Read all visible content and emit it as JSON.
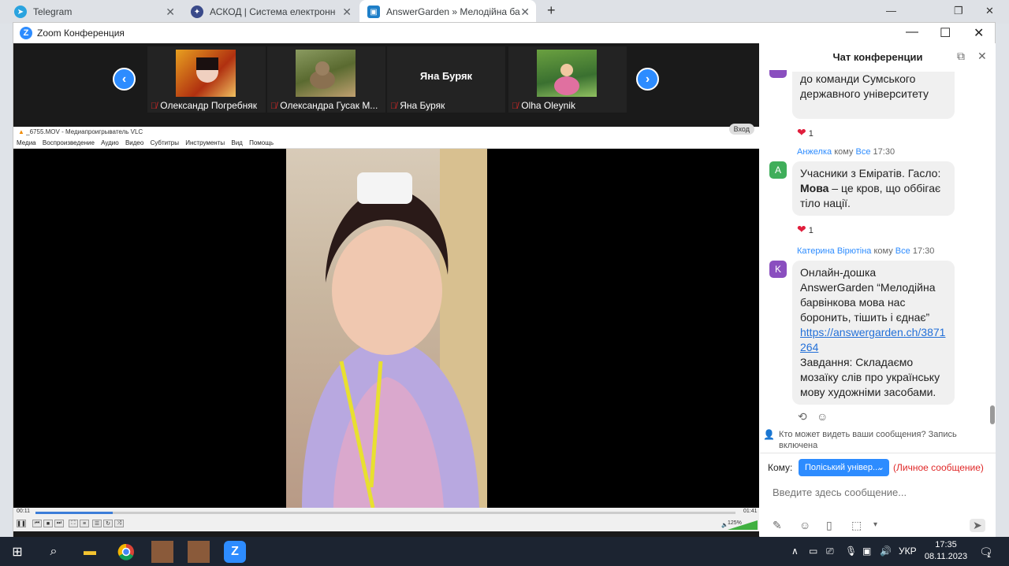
{
  "browser": {
    "tabs": [
      {
        "title": "Telegram",
        "icon": "telegram-icon",
        "active": false
      },
      {
        "title": "АСКОД | Система електронного",
        "icon": "askod-icon",
        "active": false
      },
      {
        "title": "AnswerGarden » Мелодійна бар",
        "icon": "answergarden-icon",
        "active": true
      }
    ],
    "new_tab": "+",
    "minimize": "—",
    "restore": "❐",
    "close": "✕"
  },
  "zoom": {
    "title": "Zoom Конференция",
    "logo": "Z",
    "minimize": "—",
    "maximize": "☐",
    "close": "✕",
    "participants": [
      {
        "name": "Олександр Погребняк",
        "muted": true
      },
      {
        "name": "Олександра Гусак М...",
        "muted": true
      },
      {
        "name": "Яна Буряк",
        "display_name": "Яна Буряк",
        "muted": true
      },
      {
        "name": "Olha Oleynik",
        "muted": true
      }
    ],
    "prev": "‹",
    "next": "›"
  },
  "vlc": {
    "title": "_6755.MOV - Медиапроигрыватель VLC",
    "menu": [
      "Медиа",
      "Воспроизведение",
      "Аудио",
      "Видео",
      "Субтитры",
      "Инструменты",
      "Вид",
      "Помощь"
    ],
    "exit_label": "Вход",
    "time_elapsed": "00:11",
    "time_total": "01:41",
    "progress": 0.11,
    "volume": "125%"
  },
  "chat": {
    "header": "Чат конференции",
    "partial_message": "з учасниці з Іспанії, входжу до команди Сумського державного університету",
    "partial_reaction": "1",
    "messages": [
      {
        "sender": "Анжелка",
        "to_word": "кому",
        "recipient": "Все",
        "time": "17:30",
        "avatar": "A",
        "text_before": "Учасники з Еміратів. Гасло: ",
        "text_bold": "Мова",
        "text_after": " – це кров, що оббігає тіло нації.",
        "reaction": "1"
      },
      {
        "sender": "Катерина Вірютіна",
        "to_word": "кому",
        "recipient": "Все",
        "time": "17:30",
        "avatar": "K",
        "text1": "Онлайн-дошка AnswerGarden “Мелодійна барвінкова мова нас боронить, тішить і єднає”",
        "link": "https://answergarden.ch/3871264",
        "text2": "Завдання: Складаємо мозаїку слів про українську мову художніми засобами."
      }
    ],
    "privacy_note": "Кто может видеть ваши сообщения? Запись включена",
    "to_label": "Кому:",
    "to_value": "Поліський універ...",
    "private_label": "(Личное сообщение)",
    "input_placeholder": "Введите здесь сообщение..."
  },
  "taskbar": {
    "lang": "УКР",
    "time": "17:35",
    "date": "08.11.2023",
    "notifications": "1"
  }
}
